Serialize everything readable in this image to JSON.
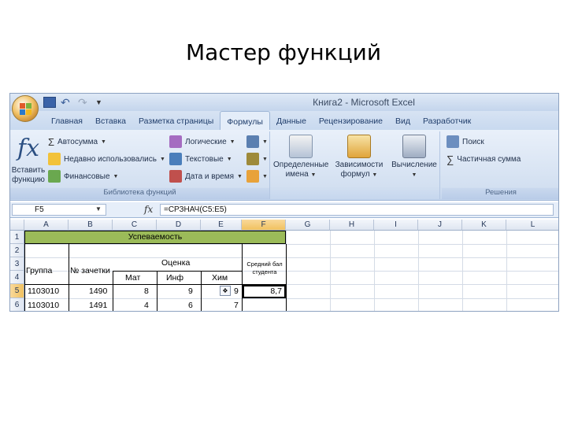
{
  "slide": {
    "title": "Мастер функций"
  },
  "window": {
    "title": "Книга2 - Microsoft Excel"
  },
  "qat": {
    "save_icon": "save-icon",
    "undo_icon": "undo-icon",
    "redo_icon": "redo-icon"
  },
  "tabs": [
    "Главная",
    "Вставка",
    "Разметка страницы",
    "Формулы",
    "Данные",
    "Рецензирование",
    "Вид",
    "Разработчик"
  ],
  "ribbon": {
    "insert_function": {
      "line1": "Вставить",
      "line2": "функцию"
    },
    "autosum": "Автосумма",
    "recent": "Недавно использовались",
    "financial": "Финансовые",
    "logical": "Логические",
    "text": "Текстовые",
    "datetime": "Дата и время",
    "group_library": "Библиотека функций",
    "defined_names": {
      "line1": "Определенные",
      "line2": "имена"
    },
    "dependencies": {
      "line1": "Зависимости",
      "line2": "формул"
    },
    "calculation": "Вычисление",
    "search": "Поиск",
    "partial_sum": "Частичная сумма",
    "group_solutions": "Решения"
  },
  "formula_bar": {
    "name": "F5",
    "formula": "=СРЗНАЧ(C5:E5)"
  },
  "columns": [
    "A",
    "B",
    "C",
    "D",
    "E",
    "F",
    "G",
    "H",
    "I",
    "J",
    "K",
    "L"
  ],
  "rows": [
    "1",
    "2",
    "3",
    "4",
    "5",
    "6"
  ],
  "sheet": {
    "header_title": "Успеваемость",
    "group": "Группа",
    "record_book": "№ зачетки",
    "grade": "Оценка",
    "avg_line1": "Средний бал",
    "avg_line2": "студента",
    "math": "Мат",
    "inf": "Инф",
    "chem": "Хим",
    "r5": {
      "group": "1103010",
      "book": "1490",
      "math": "8",
      "inf": "9",
      "chem": "9",
      "avg": "8,7"
    },
    "r6": {
      "group": "1103010",
      "book": "1491",
      "math": "4",
      "inf": "6",
      "chem": "7"
    }
  },
  "colors": {
    "header_fill": "#9bbb59",
    "selection": "#f1c15f",
    "ribbon": "#d3e0f1"
  }
}
